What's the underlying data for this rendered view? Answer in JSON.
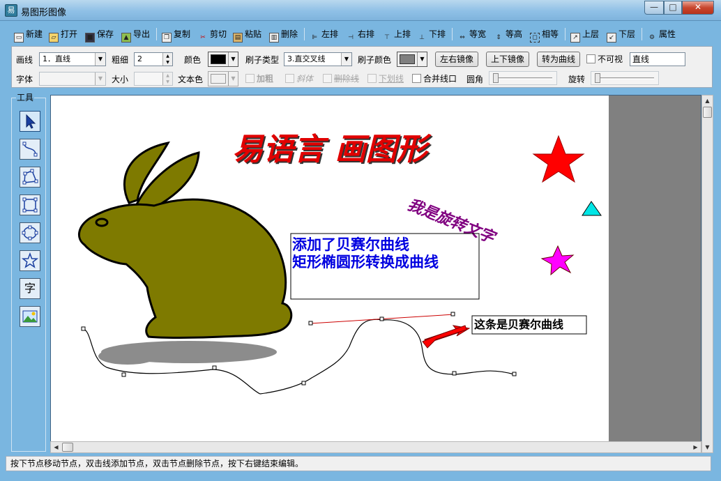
{
  "window": {
    "title": "易图形图像",
    "icon": "app-logo-icon",
    "controls": {
      "minimize": "—",
      "maximize": "□",
      "close": "✕"
    }
  },
  "toolbar": {
    "new": "新建",
    "open": "打开",
    "save": "保存",
    "export": "导出",
    "copy": "复制",
    "cut": "剪切",
    "paste": "粘贴",
    "delete": "删除",
    "align_left": "左排",
    "align_right": "右排",
    "align_top": "上排",
    "align_bottom": "下排",
    "equal_width": "等宽",
    "equal_height": "等高",
    "equal_size": "相等",
    "bring_up": "上层",
    "send_down": "下层",
    "properties": "属性"
  },
  "props": {
    "line_label": "画线",
    "line_value": "1．直线",
    "weight_label": "粗细",
    "weight_value": "2",
    "color_label": "颜色",
    "line_color": "#000000",
    "brush_type_label": "刷子类型",
    "brush_type_value": "3.直交叉线",
    "brush_color_label": "刷子颜色",
    "brush_color": "#808080",
    "mirror_lr": "左右镜像",
    "mirror_ud": "上下镜像",
    "to_curve": "转为曲线",
    "invisible_label": "不可视",
    "shape_name": "直线",
    "font_label": "字体",
    "font_value": "",
    "size_label": "大小",
    "size_value": "",
    "text_color_label": "文本色",
    "text_color": "#f0f0f0",
    "bold": "加粗",
    "italic": "斜体",
    "strike": "删除线",
    "underline": "下划线",
    "merge_lines": "合并线口",
    "corner_label": "圆角",
    "rotate_label": "旋转"
  },
  "tools": {
    "caption": "工具",
    "items": [
      "arrow-select-icon",
      "curve-node-icon",
      "polygon-icon",
      "rectangle-icon",
      "ellipse-icon",
      "star-icon",
      "text-tool-icon",
      "image-tool-icon"
    ],
    "text_glyph": "字",
    "selected": "arrow-select-icon"
  },
  "canvas": {
    "title_text": "易语言  画图形",
    "rotated_text": "我是旋转文字",
    "box_line1": "添加了贝赛尔曲线",
    "box_line2": "矩形椭圆形转换成曲线",
    "bezier_label": "这条是贝赛尔曲线",
    "rabbit_color": "#7e7a00",
    "shadow_color": "#8c8c8c",
    "star_red": "#ff0000",
    "triangle_cyan": "#00e6e6",
    "star_magenta": "#ff00ff",
    "arrow_red": "#ff0000",
    "title_color": "#e00000",
    "rotated_color": "#800080",
    "box_text_color": "#0000e0"
  },
  "status": {
    "text": "按下节点移动节点，双击线添加节点，双击节点删除节点，按下右键结束编辑。"
  }
}
